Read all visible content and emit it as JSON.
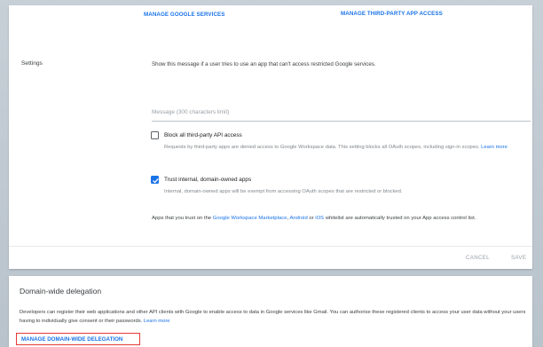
{
  "top_links": {
    "manage_google_services": "MANAGE GOOGLE SERVICES",
    "manage_third_party_app_access": "MANAGE THIRD-PARTY APP ACCESS"
  },
  "settings": {
    "label": "Settings",
    "description": "Show this message if a user tries to use an app that can't access restricted Google services.",
    "message_placeholder": "Message (300 characters limit)",
    "message_value": ""
  },
  "options": [
    {
      "title": "Block all third-party API access",
      "checked": false,
      "description": "Requests by third-party apps are denied access to Google Workspace data. This setting blocks all OAuth scopes, including sign-in scopes.",
      "learn_more": "Learn more"
    },
    {
      "title": "Trust internal, domain-owned apps",
      "checked": true,
      "description": "Internal, domain-owned apps will be exempt from accessing OAuth scopes that are restricted or blocked."
    }
  ],
  "trust_note": {
    "prefix": "Apps that you trust on the ",
    "marketplace_link": "Google Workspace Marketplace",
    "comma": ", ",
    "android_link": "Android",
    "or": " or ",
    "ios_link": "iOS",
    "suffix": " whitelist are automatically trusted on your App access control list."
  },
  "actions": {
    "cancel": "CANCEL",
    "save": "SAVE"
  },
  "domain_wide_delegation": {
    "title": "Domain-wide delegation",
    "description": "Developers can register their web applications and other API clients with Google to enable access to data in Google services like Gmail. You can authorise these registered clients to access your user data without your users having to individually give consent or their passwords.",
    "learn_more": "Learn more",
    "manage_link": "MANAGE DOMAIN-WIDE DELEGATION"
  },
  "colors": {
    "link": "#1a73e8",
    "highlight_border": "#e53935",
    "checkbox_checked": "#1a73e8"
  }
}
